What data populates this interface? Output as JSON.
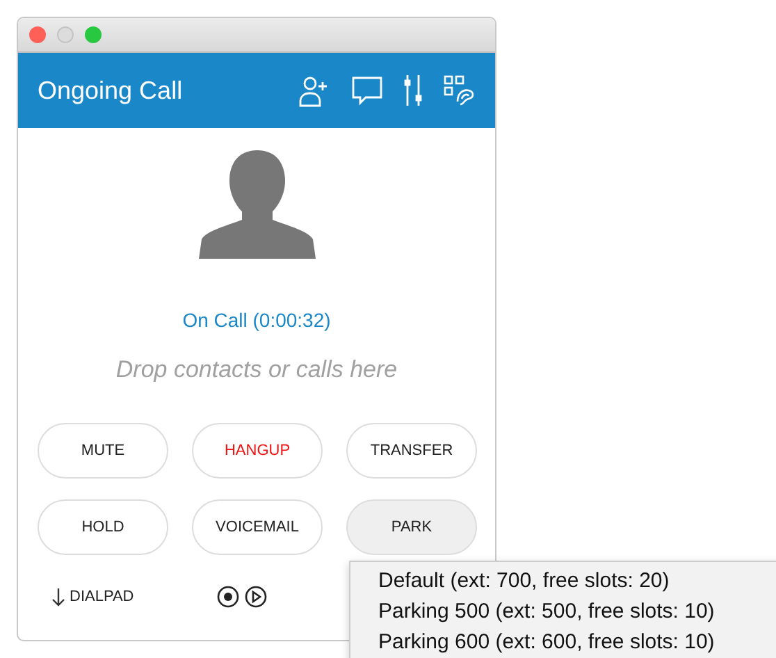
{
  "window": {
    "title": "Ongoing Call"
  },
  "status": "On Call (0:00:32)",
  "drop_placeholder": "Drop contacts or calls here",
  "buttons": [
    {
      "label": "MUTE",
      "kind": "normal",
      "pressed": false
    },
    {
      "label": "HANGUP",
      "kind": "danger",
      "pressed": false
    },
    {
      "label": "TRANSFER",
      "kind": "normal",
      "pressed": false
    },
    {
      "label": "HOLD",
      "kind": "normal",
      "pressed": false
    },
    {
      "label": "VOICEMAIL",
      "kind": "normal",
      "pressed": false
    },
    {
      "label": "PARK",
      "kind": "normal",
      "pressed": true
    }
  ],
  "footer": {
    "dialpad": "DIALPAD"
  },
  "park_menu": [
    "Default (ext: 700, free slots: 20)",
    "Parking 500 (ext: 500, free slots: 10)",
    "Parking 600 (ext: 600, free slots: 10)"
  ]
}
